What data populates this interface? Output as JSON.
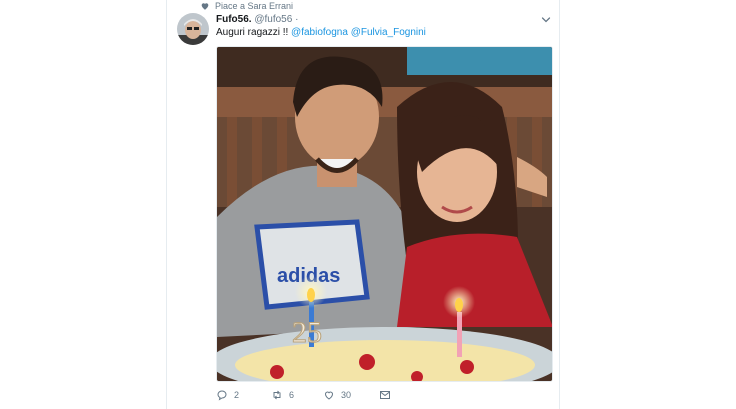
{
  "social_context": "Piace a Sara Errani",
  "tweet": {
    "display_name": "Fufo56.",
    "handle": "@fufo56",
    "separator": "·",
    "text_prefix": "Auguri ragazzi !!",
    "mentions": [
      "@fabiofogna",
      "@Fulvia_Fognini"
    ],
    "candle_numbers": "25"
  },
  "actions": {
    "reply_count": "2",
    "retweet_count": "6",
    "like_count": "30"
  },
  "colors": {
    "link": "#1b95e0",
    "muted": "#657786",
    "text": "#14171a",
    "border": "#e6ecf0"
  },
  "icons": [
    "heart-icon",
    "avatar",
    "chevron-down-icon",
    "reply-icon",
    "retweet-icon",
    "like-icon",
    "direct-message-icon"
  ]
}
